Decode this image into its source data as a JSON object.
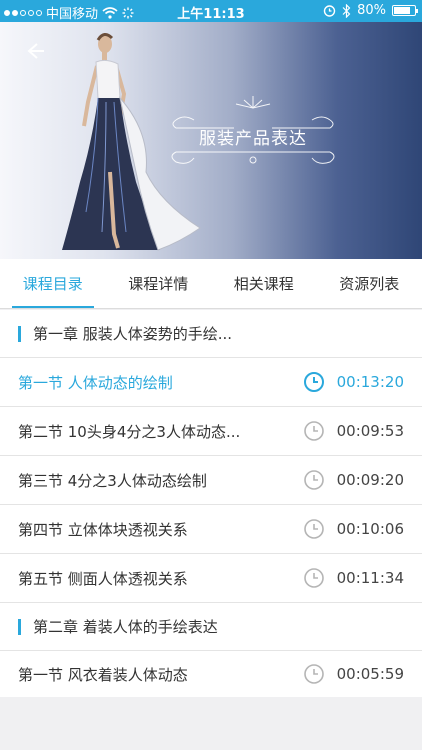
{
  "status_bar": {
    "carrier": "中国移动",
    "time": "上午11:13",
    "battery": "80%",
    "battery_level": 0.8
  },
  "banner": {
    "title": "服装产品表达"
  },
  "tabs": [
    {
      "label": "课程目录",
      "active": true
    },
    {
      "label": "课程详情",
      "active": false
    },
    {
      "label": "相关课程",
      "active": false
    },
    {
      "label": "资源列表",
      "active": false
    }
  ],
  "list": {
    "chapter1": {
      "title": "第一章 服装人体姿势的手绘..."
    },
    "lessons1": [
      {
        "name": "第一节 人体动态的绘制",
        "duration": "00:13:20",
        "active": true
      },
      {
        "name": "第二节 10头身4分之3人体动态...",
        "duration": "00:09:53",
        "active": false
      },
      {
        "name": "第三节 4分之3人体动态绘制",
        "duration": "00:09:20",
        "active": false
      },
      {
        "name": "第四节 立体体块透视关系",
        "duration": "00:10:06",
        "active": false
      },
      {
        "name": "第五节 侧面人体透视关系",
        "duration": "00:11:34",
        "active": false
      }
    ],
    "chapter2": {
      "title": "第二章 着装人体的手绘表达"
    },
    "lessons2": [
      {
        "name": "第一节 风衣着装人体动态",
        "duration": "00:05:59",
        "active": false
      }
    ]
  },
  "colors": {
    "accent": "#2aa8dc",
    "status_bar": "#2aa8dc",
    "banner_dark": "#2f4676"
  },
  "icons": [
    "signal-dots-icon",
    "wifi-icon",
    "loading-icon",
    "alarm-icon",
    "bluetooth-icon",
    "battery-icon",
    "back-arrow-icon",
    "clock-icon"
  ]
}
